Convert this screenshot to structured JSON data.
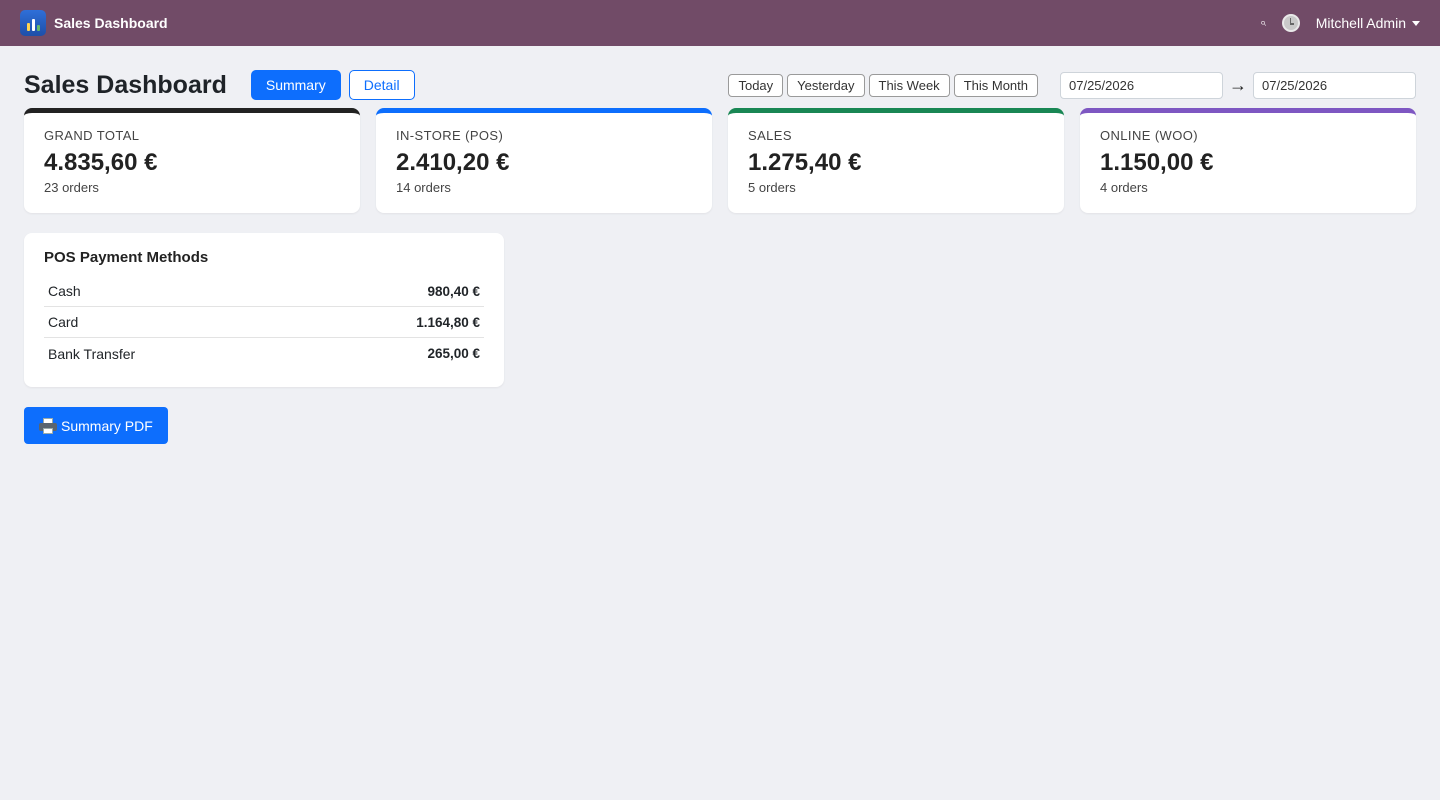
{
  "navbar": {
    "app_title": "Sales Dashboard",
    "user_name": "Mitchell Admin",
    "search_glyph": "⌕",
    "bg_color": "#714b67"
  },
  "header": {
    "title": "Sales Dashboard",
    "view_tabs": {
      "summary": "Summary",
      "detail": "Detail"
    },
    "ranges": [
      "Today",
      "Yesterday",
      "This Week",
      "This Month"
    ],
    "date_from": "07/25/2026",
    "date_to": "07/25/2026",
    "arrow": "→"
  },
  "kpis": [
    {
      "label": "GRAND TOTAL",
      "value": "4.835,60 €",
      "sub": "23 orders",
      "accent": "#222222"
    },
    {
      "label": "IN-STORE (POS)",
      "value": "2.410,20 €",
      "sub": "14 orders",
      "accent": "#0d6efd"
    },
    {
      "label": "SALES",
      "value": "1.275,40 €",
      "sub": "5 orders",
      "accent": "#198754"
    },
    {
      "label": "ONLINE (WOO)",
      "value": "1.150,00 €",
      "sub": "4 orders",
      "accent": "#7e57c2"
    }
  ],
  "payment_methods": {
    "title": "POS Payment Methods",
    "rows": [
      {
        "name": "Cash",
        "amount": "980,40 €"
      },
      {
        "name": "Card",
        "amount": "1.164,80 €"
      },
      {
        "name": "Bank Transfer",
        "amount": "265,00 €"
      }
    ]
  },
  "actions": {
    "pdf_label": "Summary PDF"
  },
  "colors": {
    "primary": "#0d6efd",
    "page_bg": "#eff0f4"
  }
}
